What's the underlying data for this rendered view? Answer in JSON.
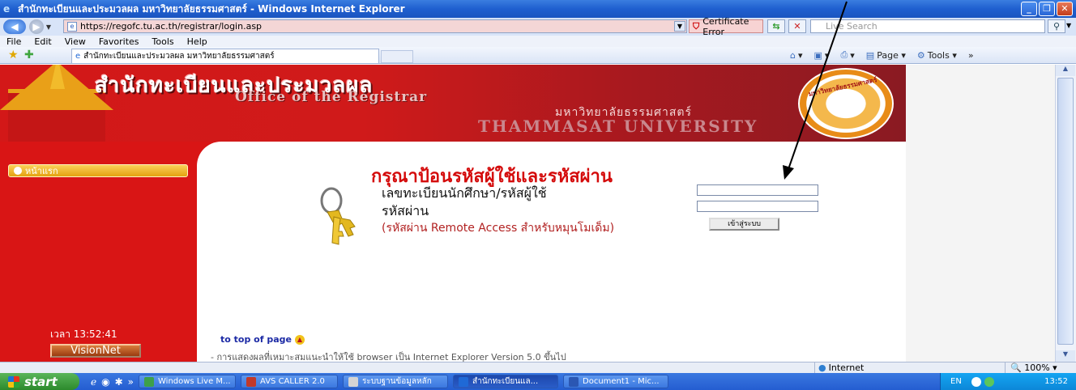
{
  "window": {
    "title": "สำนักทะเบียนและประมวลผล มหาวิทยาลัยธรรมศาสตร์ - Windows Internet Explorer",
    "buttons": {
      "minimize": "_",
      "restore": "❐",
      "close": "✕"
    }
  },
  "addressbar": {
    "url": "https://regofc.tu.ac.th/registrar/login.asp",
    "cert_error": "Certificate Error",
    "search_placeholder": "Live Search"
  },
  "menubar": {
    "items": [
      "File",
      "Edit",
      "View",
      "Favorites",
      "Tools",
      "Help"
    ]
  },
  "tabs": [
    {
      "label": "สำนักทะเบียนและประมวลผล มหาวิทยาลัยธรรมศาสตร์"
    }
  ],
  "commandbar": {
    "page_label": "Page",
    "tools_label": "Tools"
  },
  "header": {
    "title_th": "สำนักทะเบียนและประมวลผล",
    "title_en": "Office of the Registrar",
    "university_th": "มหาวิทยาลัยธรรมศาสตร์",
    "university_en": "THAMMASAT UNIVERSITY",
    "seal_text": "มหาวิทยาลัยธรรมศาสตร์"
  },
  "sidebar": {
    "home_label": "หน้าแรก",
    "clock": "เวลา 13:52:41",
    "visionnet_label": "VisionNet"
  },
  "login": {
    "title": "กรุณาป้อนรหัสผู้ใช้และรหัสผ่าน",
    "username_label": "เลขทะเบียนนักศึกษา/รหัสผู้ใช้",
    "password_label": "รหัสผ่าน",
    "note": "(รหัสผ่าน Remote Access สำหรับหมุนโมเด็ม)",
    "submit_label": "เข้าสู่ระบบ",
    "username_value": "",
    "password_value": ""
  },
  "footer": {
    "to_top": "to top of page",
    "note": "- การแสดงผลที่เหมาะสมแนะนำให้ใช้ browser เป็น Internet Explorer Version 5.0 ขึ้นไป"
  },
  "statusbar": {
    "zone": "Internet",
    "zoom": "100%"
  },
  "taskbar": {
    "start_label": "start",
    "buttons": [
      {
        "label": "Windows Live M...",
        "color": "#3da04a"
      },
      {
        "label": "AVS CALLER 2.0",
        "color": "#c0392b"
      },
      {
        "label": "ระบบฐานข้อมูลหลัก",
        "color": "#d4d4d4"
      },
      {
        "label": "สำนักทะเบียนแล...",
        "color": "#1f69d6"
      },
      {
        "label": "Document1 - Mic...",
        "color": "#2b57b3"
      }
    ],
    "tray_lang": "EN",
    "tray_time": "13:52"
  },
  "colors": {
    "page_red": "#d91515",
    "login_title": "#d40b0b",
    "gold": "#e9a018"
  }
}
